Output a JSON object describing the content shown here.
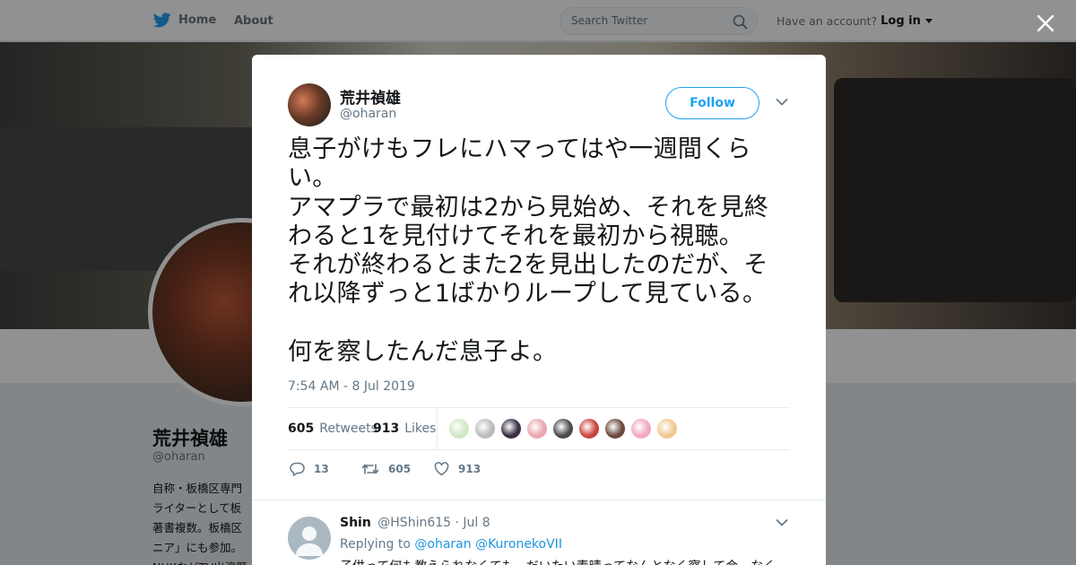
{
  "nav": {
    "home_label": "Home",
    "about_label": "About",
    "search_placeholder": "Search Twitter",
    "account_prompt": "Have an account?",
    "login_label": "Log in"
  },
  "background_profile": {
    "name": "荒井禎雄",
    "handle": "@oharan",
    "bio_lines": [
      "自称・板橋区専門",
      "ライターとして板",
      "著書複数。板橋区",
      "ニア」にも参加。",
      "NHKなどTV出演歴"
    ]
  },
  "tweet": {
    "author_name": "荒井禎雄",
    "author_handle": "@oharan",
    "follow_label": "Follow",
    "text": "息子がけもフレにハマってはや一週間くらい。\nアマプラで最初は2から見始め、それを見終わると1を見付けてそれを最初から視聴。\nそれが終わるとまた2を見出したのだが、それ以降ずっと1ばかりループして見ている。\n\n何を察したんだ息子よ。",
    "timestamp": "7:54 AM - 8 Jul 2019",
    "retweets_count": "605",
    "retweets_label": "Retweets",
    "likes_count": "913",
    "likes_label": "Likes",
    "liker_colors": [
      "#cde8c4",
      "#b9bcbd",
      "#3a2e45",
      "#e9a6b0",
      "#4b4b4b",
      "#c9433f",
      "#6b4a3e",
      "#f2a7c0",
      "#f1c98e"
    ],
    "reply_count": "13",
    "retweet_action_count": "605",
    "like_action_count": "913"
  },
  "reply": {
    "name": "Shin",
    "handle": "@HShin615",
    "date": "· Jul 8",
    "replying_to_label": "Replying to",
    "mention_1": "@oharan",
    "mention_2": "@KuronekoVII",
    "text": "子供って何も教えられなくても、だいたい素晴ってなんとなく察して会…なく"
  },
  "colors": {
    "accent": "#1da1f2",
    "link": "#1b95e0",
    "text_primary": "#14171a",
    "text_secondary": "#657786"
  }
}
